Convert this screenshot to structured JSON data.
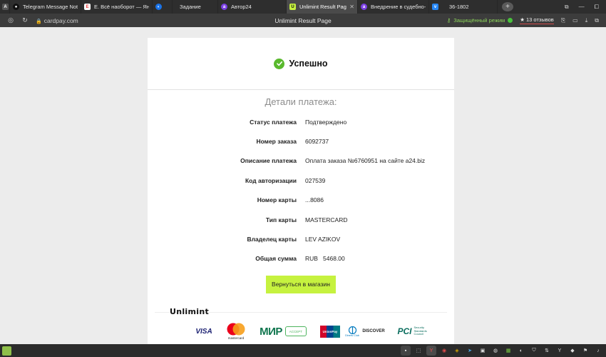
{
  "browser": {
    "tabs": [
      {
        "title": "Telegram Message Notif"
      },
      {
        "title": "Е. Всё наоборот — Янд"
      },
      {
        "title": ""
      },
      {
        "title": "Задание"
      },
      {
        "title": "Автор24"
      },
      {
        "title": "Unlimint Result Page"
      },
      {
        "title": "Внедрение в судебно-э"
      },
      {
        "title": "36-1802"
      }
    ],
    "address": {
      "url": "cardpay.com",
      "page_title": "Unlimint Result Page",
      "incognito_label": "Защищённый режим",
      "reviews_label": "★ 13 отзывов"
    }
  },
  "payment": {
    "status_title": "Успешно",
    "details_title": "Детали платежа:",
    "rows": [
      {
        "label": "Статус платежа",
        "value": "Подтверждено"
      },
      {
        "label": "Номер заказа",
        "value": "6092737"
      },
      {
        "label": "Описание платежа",
        "value": "Оплата заказа №6760951 на сайте a24.biz"
      },
      {
        "label": "Код авторизации",
        "value": "027539"
      },
      {
        "label": "Номер карты",
        "value": "...8086"
      },
      {
        "label": "Тип карты",
        "value": "MASTERCARD"
      },
      {
        "label": "Владелец карты",
        "value": "LEV AZIKOV"
      },
      {
        "label": "Общая сумма",
        "value": "RUB   5468.00"
      }
    ],
    "return_button": "Вернуться в магазин",
    "brand": "Unlimint"
  },
  "logos": {
    "visa": "VISA",
    "mastercard": "mastercard",
    "mir": "МИР",
    "mir_accept": "ACCEPT",
    "unionpay": "UnionPay",
    "diners": "Diners Club",
    "discover": "DISCOVER",
    "pci": "PCI",
    "pci_sub": "Security Standards Council"
  },
  "colors": {
    "accent": "#c6f23f",
    "success": "#59b92d",
    "page_bg": "#ececec"
  }
}
